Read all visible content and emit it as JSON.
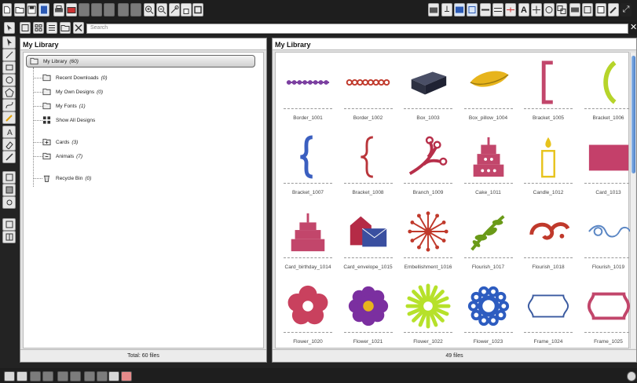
{
  "search": {
    "placeholder": "Search"
  },
  "left_panel": {
    "title": "My Library",
    "root": {
      "label": "My Library",
      "count": "(60)"
    },
    "items": [
      {
        "label": "Recent Downloads",
        "count": "(0)",
        "icon": "folder-icon"
      },
      {
        "label": "My Own Designs",
        "count": "(0)",
        "icon": "folder-icon"
      },
      {
        "label": "My Fonts",
        "count": "(1)",
        "icon": "folder-icon"
      },
      {
        "label": "Show All Designs",
        "count": "",
        "icon": "grid-icon"
      },
      {
        "label": "Cards",
        "count": "(3)",
        "icon": "folder-plus-icon"
      },
      {
        "label": "Animals",
        "count": "(7)",
        "icon": "folder-minus-icon"
      },
      {
        "label": "Recycle Bin",
        "count": "(0)",
        "icon": "trash-icon"
      }
    ],
    "footer": "Total: 60 files"
  },
  "right_panel": {
    "title": "My Library",
    "footer": "49 files",
    "items": [
      {
        "name": "Border_1001",
        "art": "border-dots",
        "color": "#7b3fa0"
      },
      {
        "name": "Border_1002",
        "art": "border-rings",
        "color": "#c0392b"
      },
      {
        "name": "Box_1003",
        "art": "box",
        "color": "#2d3142"
      },
      {
        "name": "Box_pillow_1004",
        "art": "pillow",
        "color": "#e7b41c"
      },
      {
        "name": "Bracket_1005",
        "art": "square-bracket",
        "color": "#c2466b"
      },
      {
        "name": "Bracket_1006",
        "art": "paren",
        "color": "#b6d42a"
      },
      {
        "name": "Bracket_1007",
        "art": "curly",
        "color": "#3b5fc0"
      },
      {
        "name": "Bracket_1008",
        "art": "curly-thin",
        "color": "#b9353a"
      },
      {
        "name": "Branch_1009",
        "art": "branch",
        "color": "#b72f4a"
      },
      {
        "name": "Cake_1011",
        "art": "cake",
        "color": "#c2466b"
      },
      {
        "name": "Candle_1012",
        "art": "candle",
        "color": "#e7c31c"
      },
      {
        "name": "Card_1013",
        "art": "card",
        "color": "#c4406a"
      },
      {
        "name": "Card_birthday_1014",
        "art": "cake-card",
        "color": "#c2466b"
      },
      {
        "name": "Card_envelope_1015",
        "art": "envelope",
        "color": "#b52b46"
      },
      {
        "name": "Embellishment_1016",
        "art": "burst",
        "color": "#c0392b"
      },
      {
        "name": "Flourish_1017",
        "art": "flourish-green",
        "color": "#6a9a18"
      },
      {
        "name": "Flourish_1018",
        "art": "flourish-red",
        "color": "#c0392b"
      },
      {
        "name": "Flourish_1019",
        "art": "flourish-blue",
        "color": "#5a86c4"
      },
      {
        "name": "Flower_1020",
        "art": "flower5",
        "color": "#c9415e"
      },
      {
        "name": "Flower_1021",
        "art": "flower6",
        "color": "#7b2fa0"
      },
      {
        "name": "Flower_1022",
        "art": "daisy",
        "color": "#b6e12a"
      },
      {
        "name": "Flower_1023",
        "art": "flower-dots",
        "color": "#2d5cc0"
      },
      {
        "name": "Frame_1024",
        "art": "frame-outline",
        "color": "#3a5aa0"
      },
      {
        "name": "Frame_1025",
        "art": "frame-red",
        "color": "#c2466b"
      }
    ]
  }
}
